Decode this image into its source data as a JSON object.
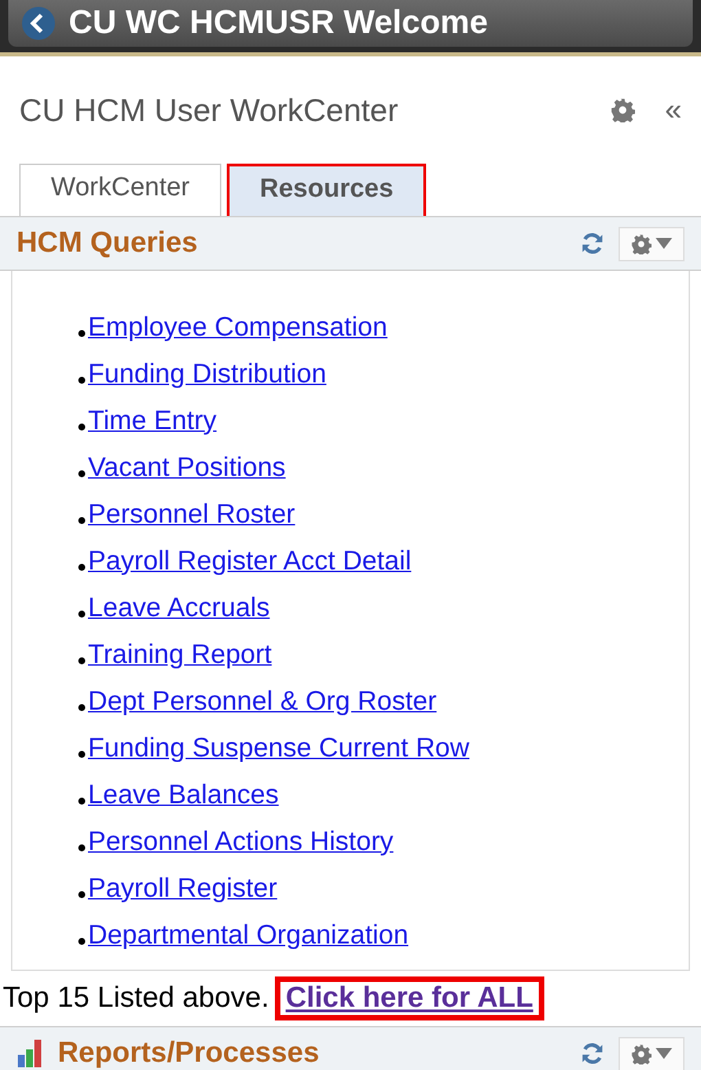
{
  "banner": {
    "title": "CU WC HCMUSR Welcome"
  },
  "header": {
    "title": "CU HCM User WorkCenter",
    "collapse": "«"
  },
  "tabs": [
    {
      "label": "WorkCenter",
      "selected": false,
      "highlighted": false
    },
    {
      "label": "Resources",
      "selected": true,
      "highlighted": true
    }
  ],
  "queries": {
    "title": "HCM Queries",
    "items": [
      "Employee Compensation",
      "Funding Distribution",
      "Time Entry",
      "Vacant Positions",
      "Personnel Roster",
      "Payroll Register Acct Detail",
      "Leave Accruals",
      "Training Report",
      "Dept Personnel & Org Roster",
      "Funding Suspense Current Row",
      "Leave Balances",
      "Personnel Actions History",
      "Payroll Register",
      "Departmental Organization"
    ]
  },
  "footer": {
    "text": "Top 15 Listed above.",
    "link": "Click here for ALL",
    "highlighted": true
  },
  "reports": {
    "title": "Reports/Processes"
  }
}
